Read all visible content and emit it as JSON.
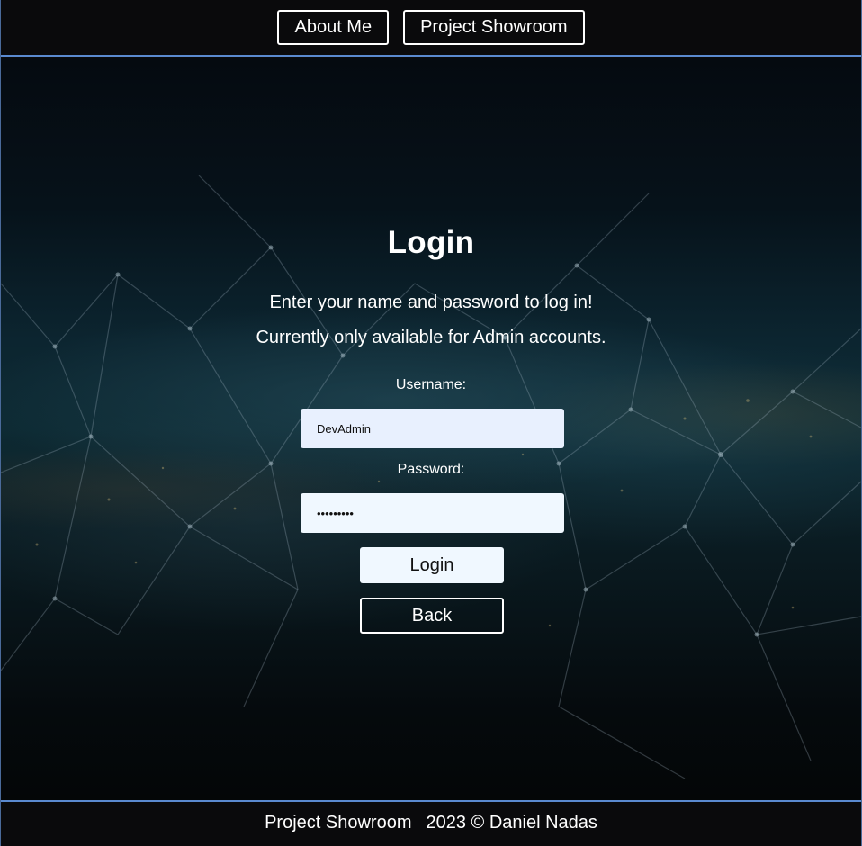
{
  "nav": {
    "items": [
      {
        "label": "About Me"
      },
      {
        "label": "Project Showroom"
      }
    ]
  },
  "background": {
    "description_icon": "city-network-background",
    "accent": "#5a8ad0"
  },
  "login": {
    "title": "Login",
    "intro_line_1": "Enter your name and password to log in!",
    "intro_line_2": "Currently only available for Admin accounts.",
    "username_label": "Username:",
    "username_value": "DevAdmin",
    "password_label": "Password:",
    "password_value": "•••••••••",
    "login_button": "Login",
    "back_button": "Back"
  },
  "footer": {
    "brand": "Project Showroom",
    "copyright": "2023 © Daniel Nadas"
  }
}
